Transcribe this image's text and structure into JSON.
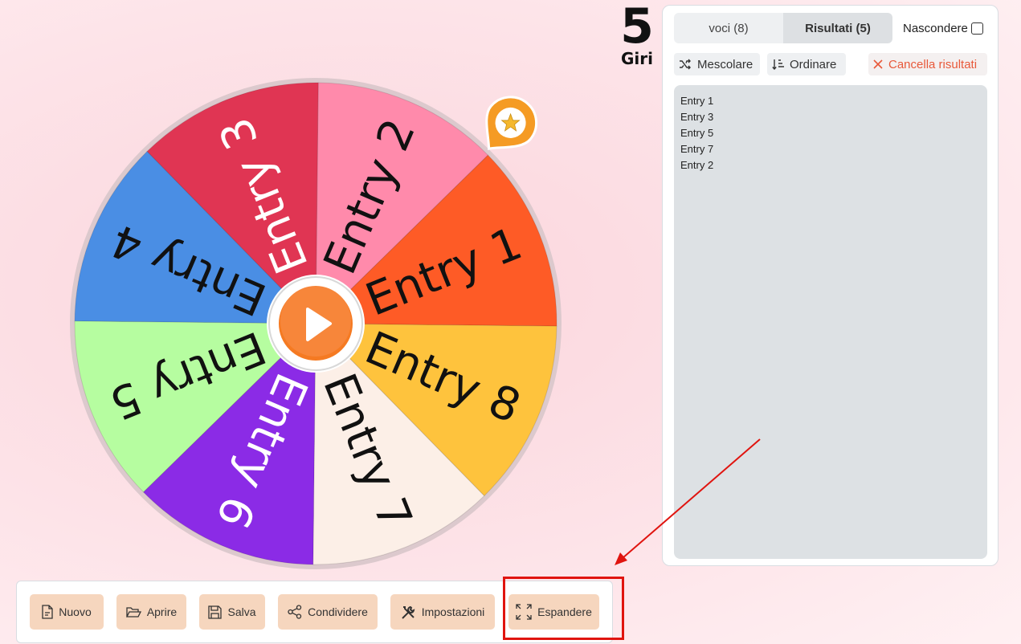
{
  "wheel": {
    "segments": [
      {
        "label": "Entry 1",
        "color": "#fe5b26",
        "text_color": "#111111"
      },
      {
        "label": "Entry 2",
        "color": "#ff8aab",
        "text_color": "#111111"
      },
      {
        "label": "Entry 3",
        "color": "#e03553",
        "text_color": "#ffffff"
      },
      {
        "label": "Entry 4",
        "color": "#4a8ee4",
        "text_color": "#111111"
      },
      {
        "label": "Entry 5",
        "color": "#b6fda0",
        "text_color": "#111111"
      },
      {
        "label": "Entry 6",
        "color": "#8b2be6",
        "text_color": "#ffffff"
      },
      {
        "label": "Entry 7",
        "color": "#fcefe7",
        "text_color": "#111111"
      },
      {
        "label": "Entry 8",
        "color": "#fec33d",
        "text_color": "#111111"
      }
    ],
    "rim_color": "#dcc9cd",
    "hub_color": "#f57a22",
    "pointer_color": "#f59b24",
    "pointer_icon": "star-icon",
    "spin_icon": "play-icon"
  },
  "spin_counter": {
    "count": "5",
    "label": "Giri"
  },
  "panel": {
    "tabs": [
      {
        "label": "voci (8)",
        "active": false
      },
      {
        "label": "Risultati (5)",
        "active": true
      }
    ],
    "hide_label": "Nascondere",
    "hide_checked": false,
    "actions": {
      "shuffle": {
        "label": "Mescolare",
        "icon": "shuffle-icon"
      },
      "sort": {
        "label": "Ordinare",
        "icon": "sort-icon"
      },
      "clear": {
        "label": "Cancella risultati",
        "icon": "close-icon"
      }
    },
    "results": [
      "Entry 1",
      "Entry 3",
      "Entry 5",
      "Entry 7",
      "Entry 2"
    ]
  },
  "toolbar": {
    "new": {
      "label": "Nuovo",
      "icon": "file-icon"
    },
    "open": {
      "label": "Aprire",
      "icon": "folder-open-icon"
    },
    "save": {
      "label": "Salva",
      "icon": "save-icon"
    },
    "share": {
      "label": "Condividere",
      "icon": "share-icon"
    },
    "settings": {
      "label": "Impostazioni",
      "icon": "tools-icon"
    },
    "expand": {
      "label": "Espandere",
      "icon": "expand-icon"
    }
  },
  "colors": {
    "toolbar_button": "#f6d6be",
    "annotation": "#e0140f",
    "clear_action": "#e8593a"
  }
}
